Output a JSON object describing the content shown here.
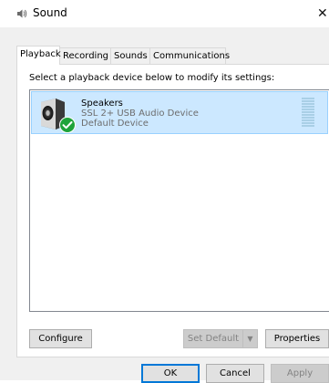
{
  "window": {
    "title": "Sound",
    "title_icon": "speaker-icon",
    "close_glyph": "✕"
  },
  "tabs": [
    {
      "label": "Playback",
      "active": true
    },
    {
      "label": "Recording",
      "active": false
    },
    {
      "label": "Sounds",
      "active": false
    },
    {
      "label": "Communications",
      "active": false
    }
  ],
  "playback": {
    "instruction": "Select a playback device below to modify its settings:",
    "devices": [
      {
        "name": "Speakers",
        "description": "SSL 2+ USB Audio Device",
        "status": "Default Device",
        "icon": "speaker-icon",
        "badge": "checkmark-icon",
        "selected": true
      }
    ],
    "buttons": {
      "configure": "Configure",
      "set_default": "Set Default",
      "set_default_arrow": "▼",
      "properties": "Properties"
    }
  },
  "dialog_buttons": {
    "ok": "OK",
    "cancel": "Cancel",
    "apply": "Apply"
  },
  "colors": {
    "selection_bg": "#cce8ff",
    "selection_border": "#99d1ff",
    "check_badge": "#1ea33a",
    "default_button_border": "#0078d7"
  }
}
